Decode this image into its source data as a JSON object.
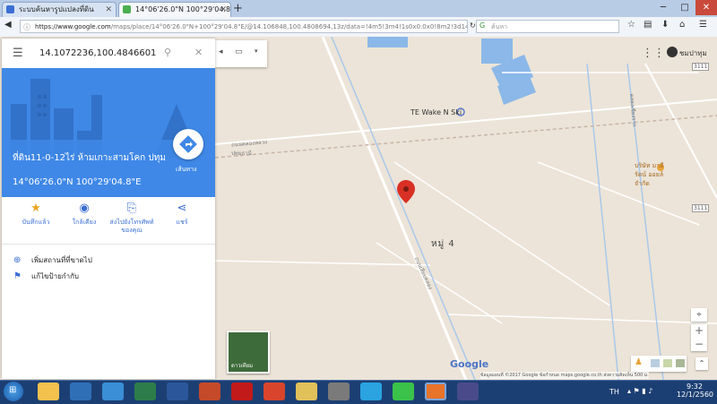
{
  "browser": {
    "tabs": [
      {
        "title": "ระบบค้นหารูปแปลงที่ดิน"
      },
      {
        "title": "14°06'26.0\"N 100°29'04.8\"E"
      }
    ],
    "new_tab": "+",
    "url_host": "https://www.google.com",
    "url_path": "/maps/place/14°06'26.0\"N+100°29'04.8\"E/@14.106848,100.4808694,13z/data=!4m5!3m4!1s0x0:0x0!8m2!3d14.1072236!4d",
    "search_placeholder": "ค้นหา"
  },
  "maps": {
    "search_value": "14.1072236,100.4846601",
    "place_title": "ที่ดิน11-0-12ไร่ ห้ามเกาะสามโคก ปทุม",
    "coordinates": "14°06'26.0\"N 100°29'04.8\"E",
    "directions_label": "เส้นทาง",
    "actions": [
      {
        "label": "บันทึกแล้ว",
        "icon": "star-icon"
      },
      {
        "label": "ใกล้เคียง",
        "icon": "nearby-icon"
      },
      {
        "label": "ส่งไปยังโทรศัพท์ของคุณ",
        "icon": "send-to-phone-icon"
      },
      {
        "label": "แชร์",
        "icon": "share-icon"
      }
    ],
    "rows": [
      {
        "label": "เพิ่มสถานที่ที่ขาดไป",
        "icon": "add-place-icon"
      },
      {
        "label": "แก้ไขป้ายกำกับ",
        "icon": "flag-icon"
      }
    ],
    "labels": {
      "wake": "TE Wake N Ski",
      "village": "หมู่ 4",
      "company": "บริษัท มาลีรัตน์ ออยล์ จำกัด",
      "road_a": "ถนนคลองหลวง",
      "road_b": "ถนนเลียบคลอง",
      "road_c": "ปทุมธานี",
      "road_d": "คลองเชียงราก",
      "route_num1": "3111",
      "route_num2": "3111",
      "satellite": "ดาวเทียม",
      "google": "Google",
      "attribution": "ข้อมูลแผนที่ ©2017 Google   ข้อกำหนด   maps.google.co.th   ส่งความคิดเห็น   500 ม."
    },
    "user": "ชมปาทุม"
  },
  "taskbar": {
    "lang": "TH",
    "time": "9:32",
    "date": "12/1/2560"
  },
  "colors": {
    "accent": "#3f88e6",
    "pin": "#d93025",
    "water": "#8bb8e8",
    "road": "#ffffff",
    "taskbar": "#1c3f73"
  }
}
